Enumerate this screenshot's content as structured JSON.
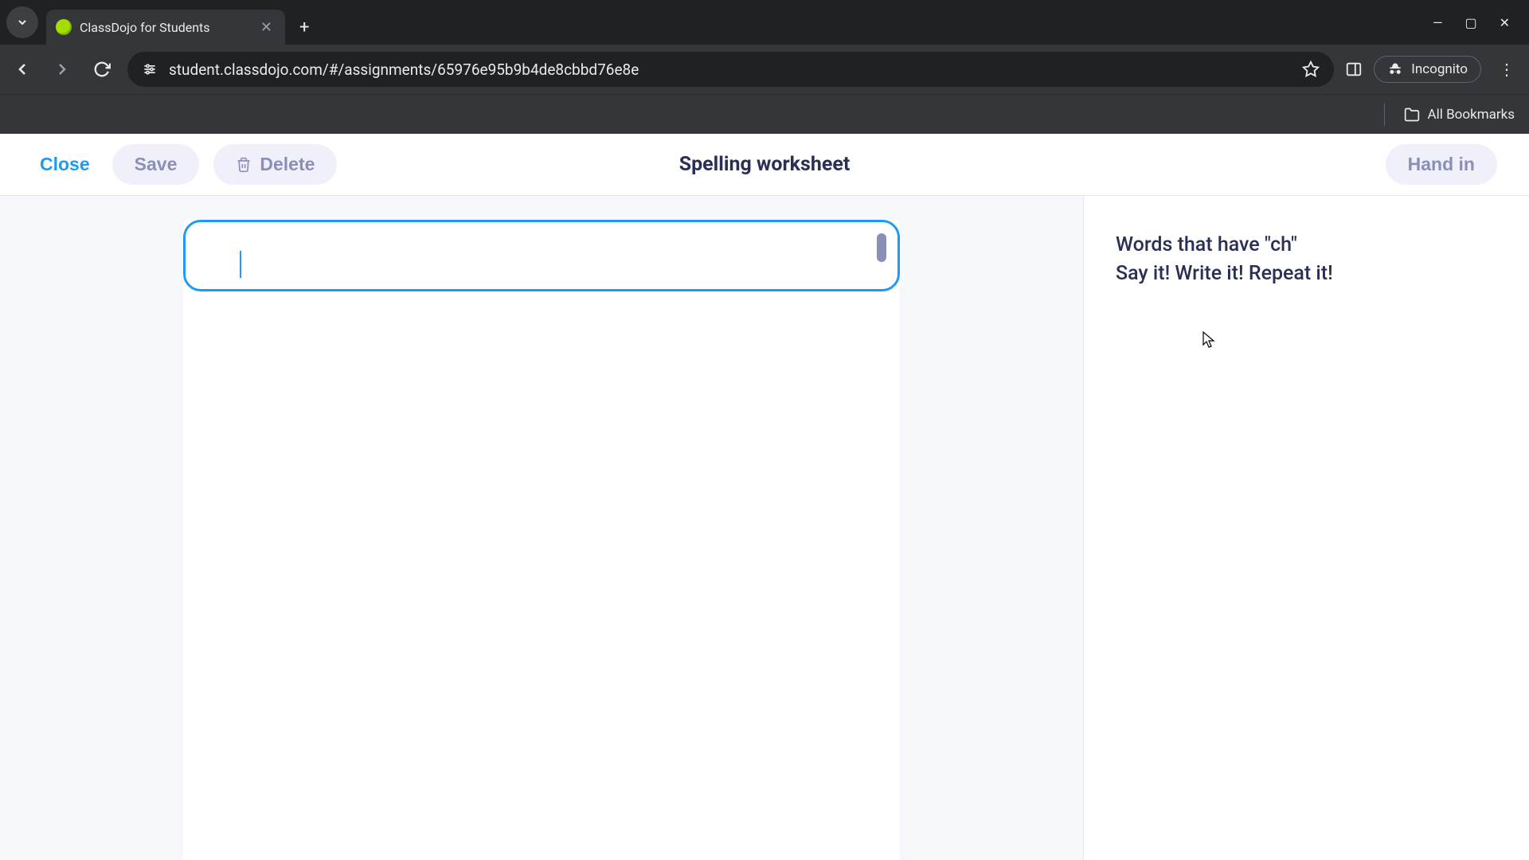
{
  "browser": {
    "tab_title": "ClassDojo for Students",
    "url": "student.classdojo.com/#/assignments/65976e95b9b4de8cbbd76e8e",
    "incognito_label": "Incognito",
    "all_bookmarks_label": "All Bookmarks"
  },
  "header": {
    "close_label": "Close",
    "save_label": "Save",
    "delete_label": "Delete",
    "title": "Spelling worksheet",
    "handin_label": "Hand in"
  },
  "editor": {
    "text_value": ""
  },
  "sidebar": {
    "instructions_line1": "Words that have \"ch\"",
    "instructions_line2": "Say it! Write it! Repeat it!"
  }
}
